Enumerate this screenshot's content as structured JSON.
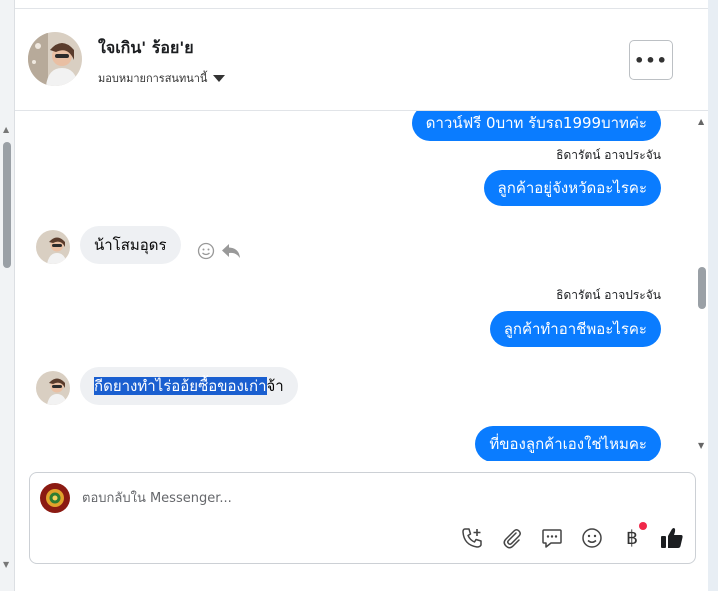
{
  "header": {
    "contact_name": "ใจเกิน' ร้อย'ย",
    "assign_label": "มอบหมายการสนทนานี้",
    "more_label": "•••"
  },
  "messages": [
    {
      "direction": "out",
      "text": "ดาวน์ฟรี 0บาท รับรถ1999บาทค่ะ"
    },
    {
      "direction": "out",
      "sender": "ธิดารัตน์ อาจประจัน",
      "text": "ลูกค้าอยู่จังหวัดอะไรคะ"
    },
    {
      "direction": "in",
      "text": "น้าโสมอุดร"
    },
    {
      "direction": "out",
      "sender": "ธิดารัตน์ อาจประจัน",
      "text": "ลูกค้าทำอาชีพอะไรคะ"
    },
    {
      "direction": "in",
      "text_highlighted": "กีดยางทำไร่ออ้ยซื้อของเก่า",
      "text_rest": "จ้า"
    },
    {
      "direction": "out",
      "text": "ที่ของลูกค้าเองใช่ไหมคะ"
    }
  ],
  "composer": {
    "placeholder": "ตอบกลับใน Messenger..."
  },
  "toolbar": {
    "icons": [
      "call-add-icon",
      "attachment-icon",
      "saved-reply-icon",
      "emoji-icon",
      "baht-payment-icon",
      "like-icon"
    ],
    "baht_symbol": "฿",
    "notification_color": "#f0284a"
  },
  "colors": {
    "outgoing_bubble": "#0a7cff",
    "incoming_bubble": "#eef0f3",
    "highlight": "#1a5fd0"
  }
}
